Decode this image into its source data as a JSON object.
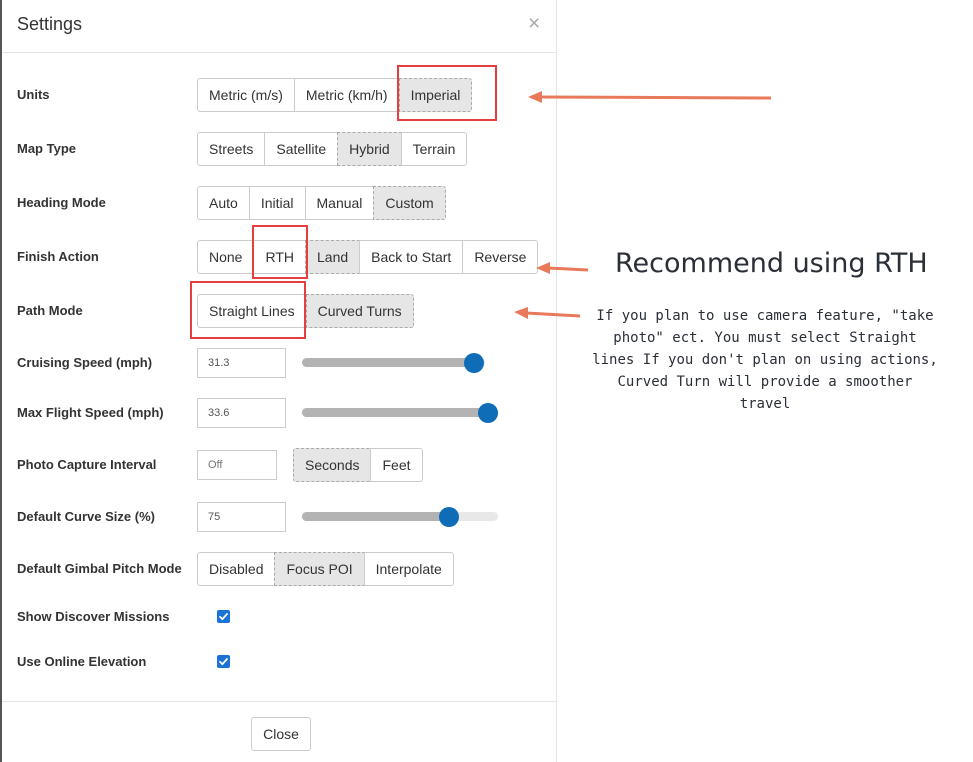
{
  "dialog": {
    "title": "Settings",
    "close_symbol": "×",
    "close_label": "Close"
  },
  "rows": {
    "units": {
      "label": "Units",
      "options": [
        "Metric (m/s)",
        "Metric (km/h)",
        "Imperial"
      ],
      "selected": "Imperial"
    },
    "map_type": {
      "label": "Map Type",
      "options": [
        "Streets",
        "Satellite",
        "Hybrid",
        "Terrain"
      ],
      "selected": "Hybrid"
    },
    "heading_mode": {
      "label": "Heading Mode",
      "options": [
        "Auto",
        "Initial",
        "Manual",
        "Custom"
      ],
      "selected": "Custom"
    },
    "finish_action": {
      "label": "Finish Action",
      "options": [
        "None",
        "RTH",
        "Land",
        "Back to Start",
        "Reverse"
      ],
      "selected": "Land"
    },
    "path_mode": {
      "label": "Path Mode",
      "options": [
        "Straight Lines",
        "Curved Turns"
      ],
      "selected": "Curved Turns"
    },
    "cruising_speed": {
      "label": "Cruising Speed (mph)",
      "value": "31.3",
      "slider_fraction": 0.94
    },
    "max_flight_speed": {
      "label": "Max Flight Speed (mph)",
      "value": "33.6",
      "slider_fraction": 1.0
    },
    "photo_capture": {
      "label": "Photo Capture Interval",
      "placeholder": "Off",
      "options": [
        "Seconds",
        "Feet"
      ],
      "selected": "Seconds"
    },
    "curve_size": {
      "label": "Default Curve Size (%)",
      "value": "75",
      "slider_fraction": 0.75
    },
    "gimbal_pitch": {
      "label": "Default Gimbal Pitch Mode",
      "options": [
        "Disabled",
        "Focus POI",
        "Interpolate"
      ],
      "selected": "Focus POI"
    },
    "show_discover": {
      "label": "Show Discover Missions",
      "checked": true
    },
    "online_elevation": {
      "label": "Use Online Elevation",
      "checked": true
    }
  },
  "annotation": {
    "title": "Recommend using RTH",
    "body": "If you plan to use camera feature, \"take photo\" ect. You must select Straight lines If you don't plan on using actions, Curved Turn will provide a smoother travel"
  },
  "colors": {
    "highlight": "#e53e3e",
    "arrow": "#e8795a",
    "slider_thumb": "#0f6cb6",
    "checkbox": "#1a73d9"
  }
}
